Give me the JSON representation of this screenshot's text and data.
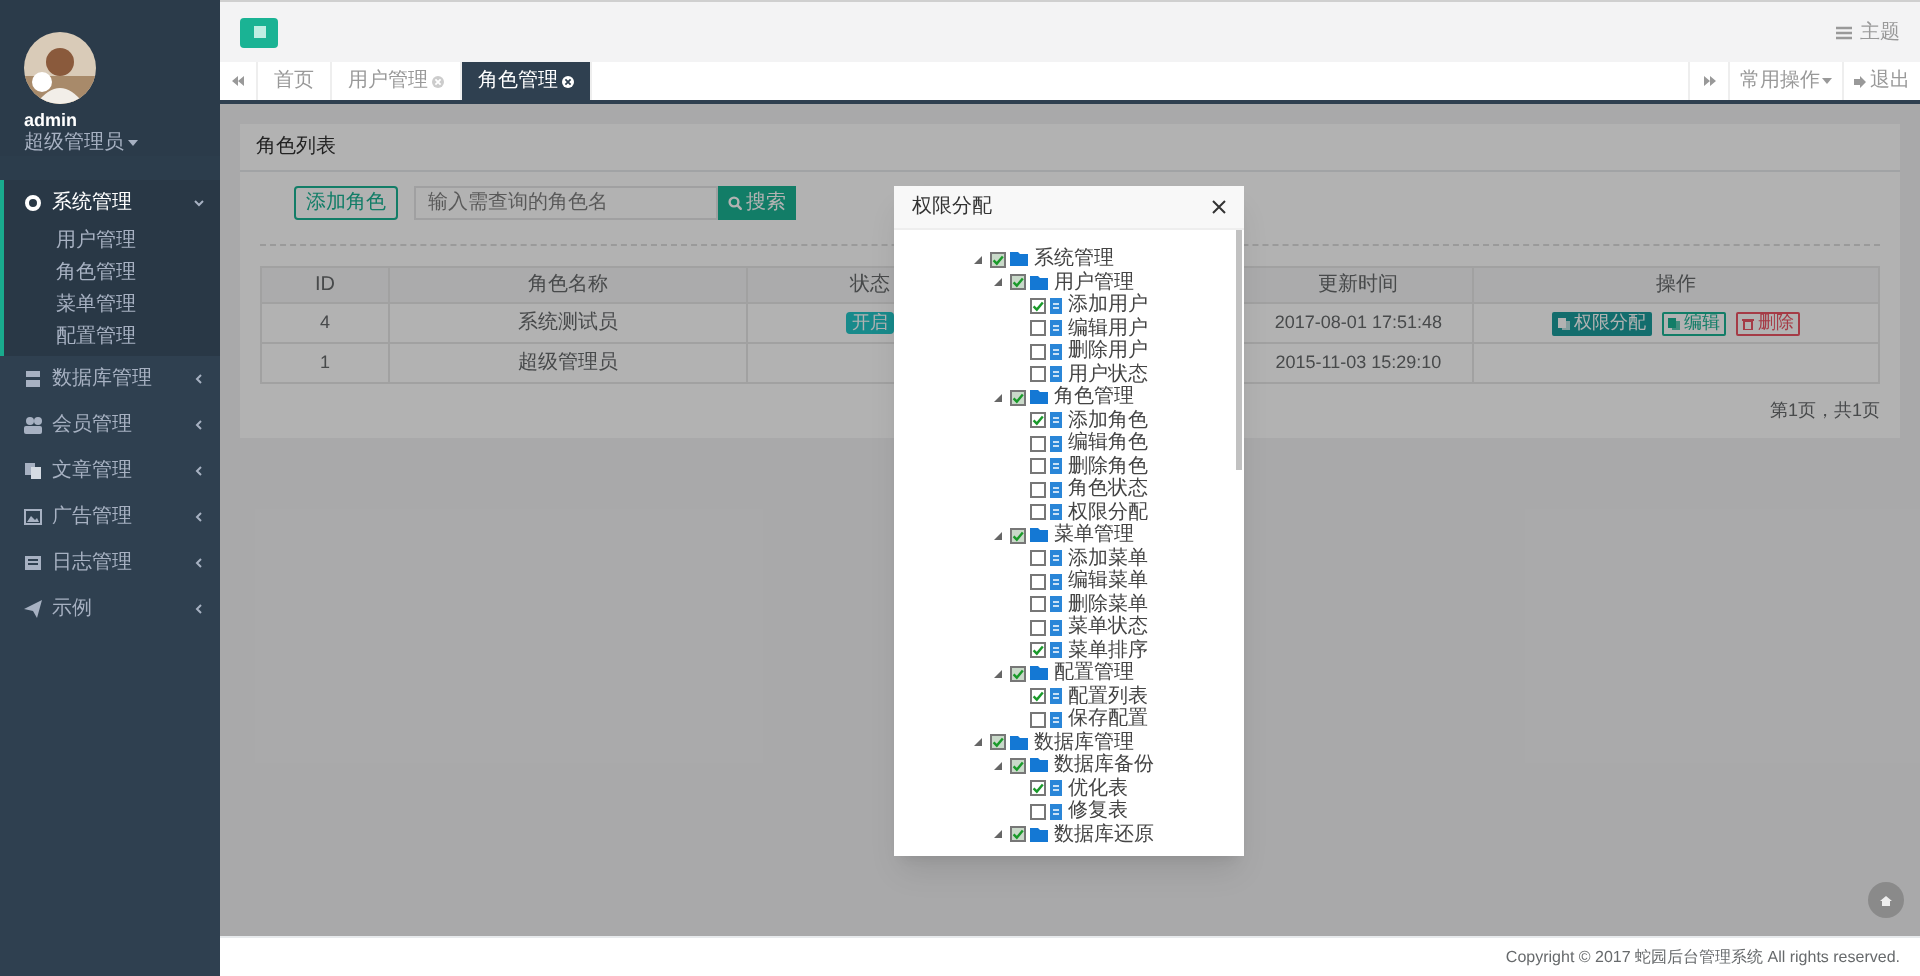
{
  "sidebar": {
    "user": {
      "name": "admin",
      "role": "超级管理员"
    },
    "menu": [
      {
        "label": "系统管理",
        "expanded": true,
        "selected": true,
        "children": [
          {
            "label": "用户管理"
          },
          {
            "label": "角色管理"
          },
          {
            "label": "菜单管理"
          },
          {
            "label": "配置管理"
          }
        ]
      },
      {
        "label": "数据库管理",
        "expanded": false,
        "selected": false
      },
      {
        "label": "会员管理",
        "expanded": false,
        "selected": false
      },
      {
        "label": "文章管理",
        "expanded": false,
        "selected": false
      },
      {
        "label": "广告管理",
        "expanded": false,
        "selected": false
      },
      {
        "label": "日志管理",
        "expanded": false,
        "selected": false
      },
      {
        "label": "示例",
        "expanded": false,
        "selected": false
      }
    ]
  },
  "topbar": {
    "theme": "主题"
  },
  "tabs": [
    {
      "label": "首页",
      "closable": false,
      "selected": false
    },
    {
      "label": "用户管理",
      "closable": true,
      "selected": false
    },
    {
      "label": "角色管理",
      "closable": true,
      "selected": true
    }
  ],
  "tab_actions": {
    "common": "常用操作",
    "logout": "退出"
  },
  "panel": {
    "title": "角色列表",
    "add_button": "添加角色",
    "search": {
      "placeholder": "输入需查询的角色名"
    },
    "search_button": "搜索",
    "table": {
      "columns": [
        "ID",
        "角色名称",
        "状态",
        "",
        "更新时间",
        "操作"
      ],
      "rows": [
        {
          "id": "4",
          "name": "系统测试员",
          "status": "开启",
          "updated": "2017-08-01 17:51:48",
          "actions": [
            "权限分配",
            "编辑",
            "删除"
          ]
        },
        {
          "id": "1",
          "name": "超级管理员",
          "updated": "2015-11-03 15:29:10"
        }
      ]
    },
    "pagination": "第1页，共1页"
  },
  "dialog": {
    "title": "权限分配",
    "tree": [
      {
        "label": "系统管理",
        "checked": true,
        "expanded": true,
        "children": [
          {
            "label": "用户管理",
            "checked": true,
            "expanded": true,
            "children": [
              {
                "label": "添加用户",
                "checked": true
              },
              {
                "label": "编辑用户",
                "checked": false
              },
              {
                "label": "删除用户",
                "checked": false
              },
              {
                "label": "用户状态",
                "checked": false
              }
            ]
          },
          {
            "label": "角色管理",
            "checked": true,
            "expanded": true,
            "children": [
              {
                "label": "添加角色",
                "checked": true
              },
              {
                "label": "编辑角色",
                "checked": false
              },
              {
                "label": "删除角色",
                "checked": false
              },
              {
                "label": "角色状态",
                "checked": false
              },
              {
                "label": "权限分配",
                "checked": false
              }
            ]
          },
          {
            "label": "菜单管理",
            "checked": true,
            "expanded": true,
            "children": [
              {
                "label": "添加菜单",
                "checked": false
              },
              {
                "label": "编辑菜单",
                "checked": false
              },
              {
                "label": "删除菜单",
                "checked": false
              },
              {
                "label": "菜单状态",
                "checked": false
              },
              {
                "label": "菜单排序",
                "checked": true
              }
            ]
          },
          {
            "label": "配置管理",
            "checked": true,
            "expanded": true,
            "children": [
              {
                "label": "配置列表",
                "checked": true
              },
              {
                "label": "保存配置",
                "checked": false
              }
            ]
          }
        ]
      },
      {
        "label": "数据库管理",
        "checked": true,
        "expanded": true,
        "children": [
          {
            "label": "数据库备份",
            "checked": true,
            "expanded": true,
            "children": [
              {
                "label": "优化表",
                "checked": true
              },
              {
                "label": "修复表",
                "checked": false
              }
            ]
          },
          {
            "label": "数据库还原",
            "checked": true,
            "expanded": true
          }
        ]
      }
    ]
  },
  "footer": "Copyright © 2017 蛇园后台管理系统 All rights reserved."
}
